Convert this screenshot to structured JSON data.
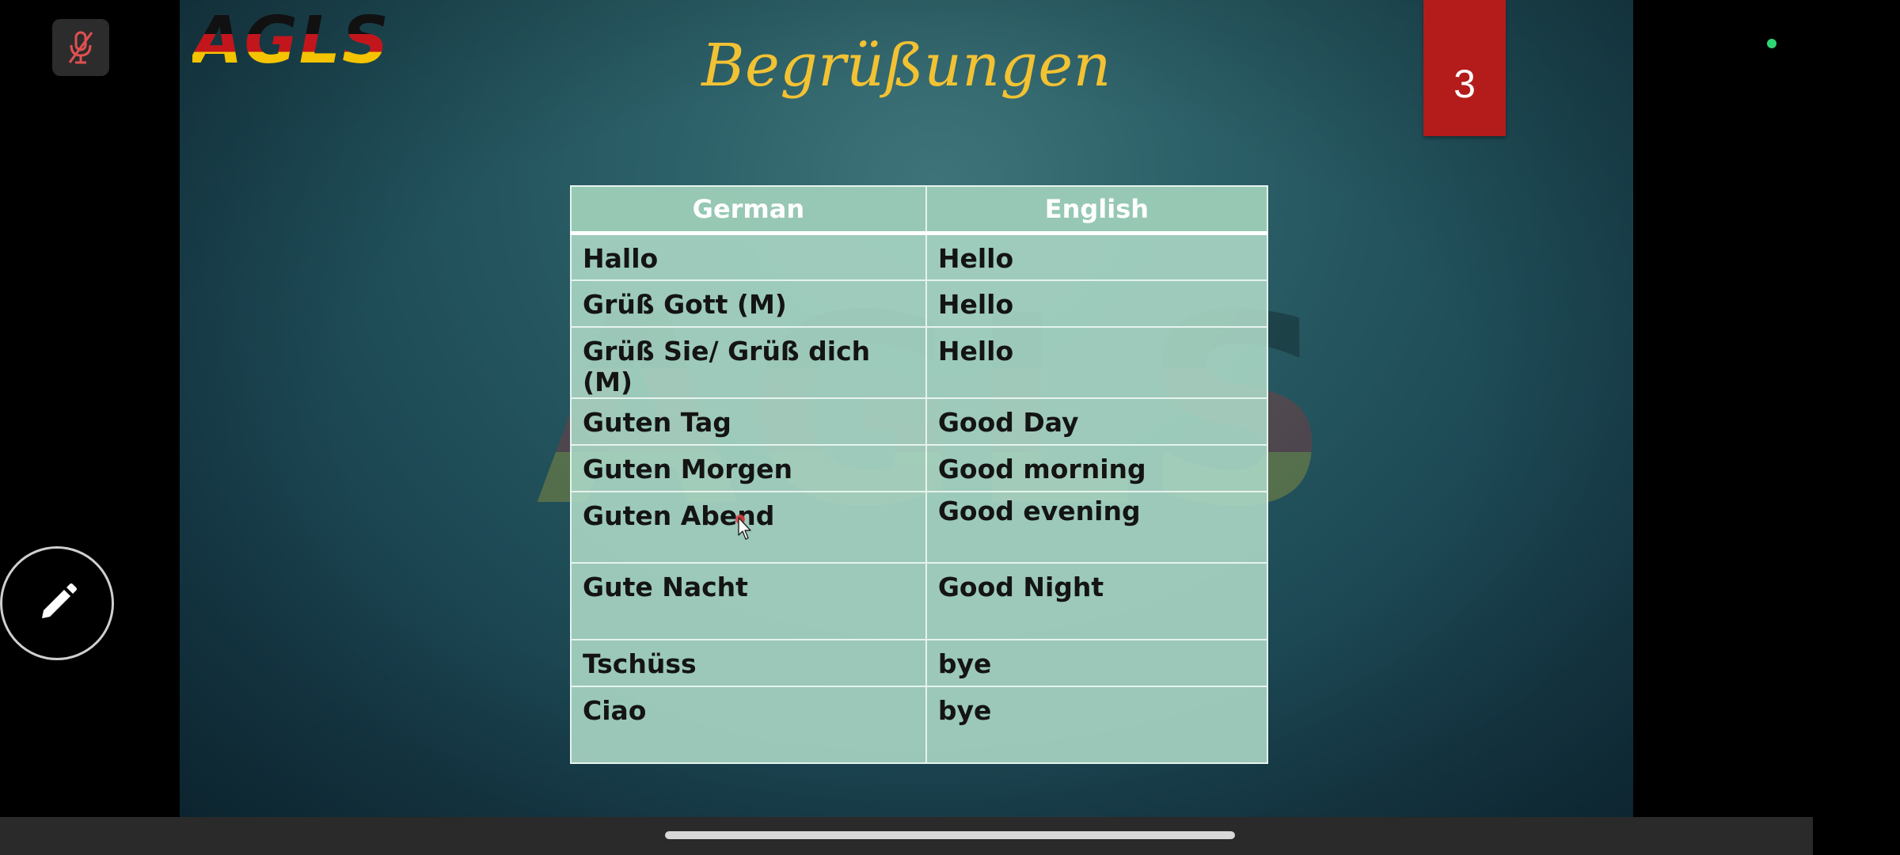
{
  "slide": {
    "logo_text": "AGLS",
    "title": "Begrüßungen",
    "page_number": "3"
  },
  "table": {
    "headers": [
      "German",
      "English"
    ],
    "rows": [
      {
        "german": "Hallo",
        "english": "Hello"
      },
      {
        "german": "Grüß Gott  (M)",
        "english": "Hello"
      },
      {
        "german": "Grüß Sie/ Grüß dich (M)",
        "english": "Hello"
      },
      {
        "german": "Guten Tag",
        "english": "Good Day"
      },
      {
        "german": "Guten Morgen",
        "english": "Good morning"
      },
      {
        "german": "Guten Abend",
        "english": "Good evening"
      },
      {
        "german": "Gute Nacht",
        "english": "Good Night"
      },
      {
        "german": "Tschüss",
        "english": "bye"
      },
      {
        "german": "Ciao",
        "english": "bye"
      }
    ]
  },
  "controls": {
    "mic_icon": "mic-off-icon",
    "annotate_icon": "pencil-icon"
  },
  "colors": {
    "title": "#f2c233",
    "page_badge": "#b41c1c",
    "status_dot": "#2ed573"
  }
}
